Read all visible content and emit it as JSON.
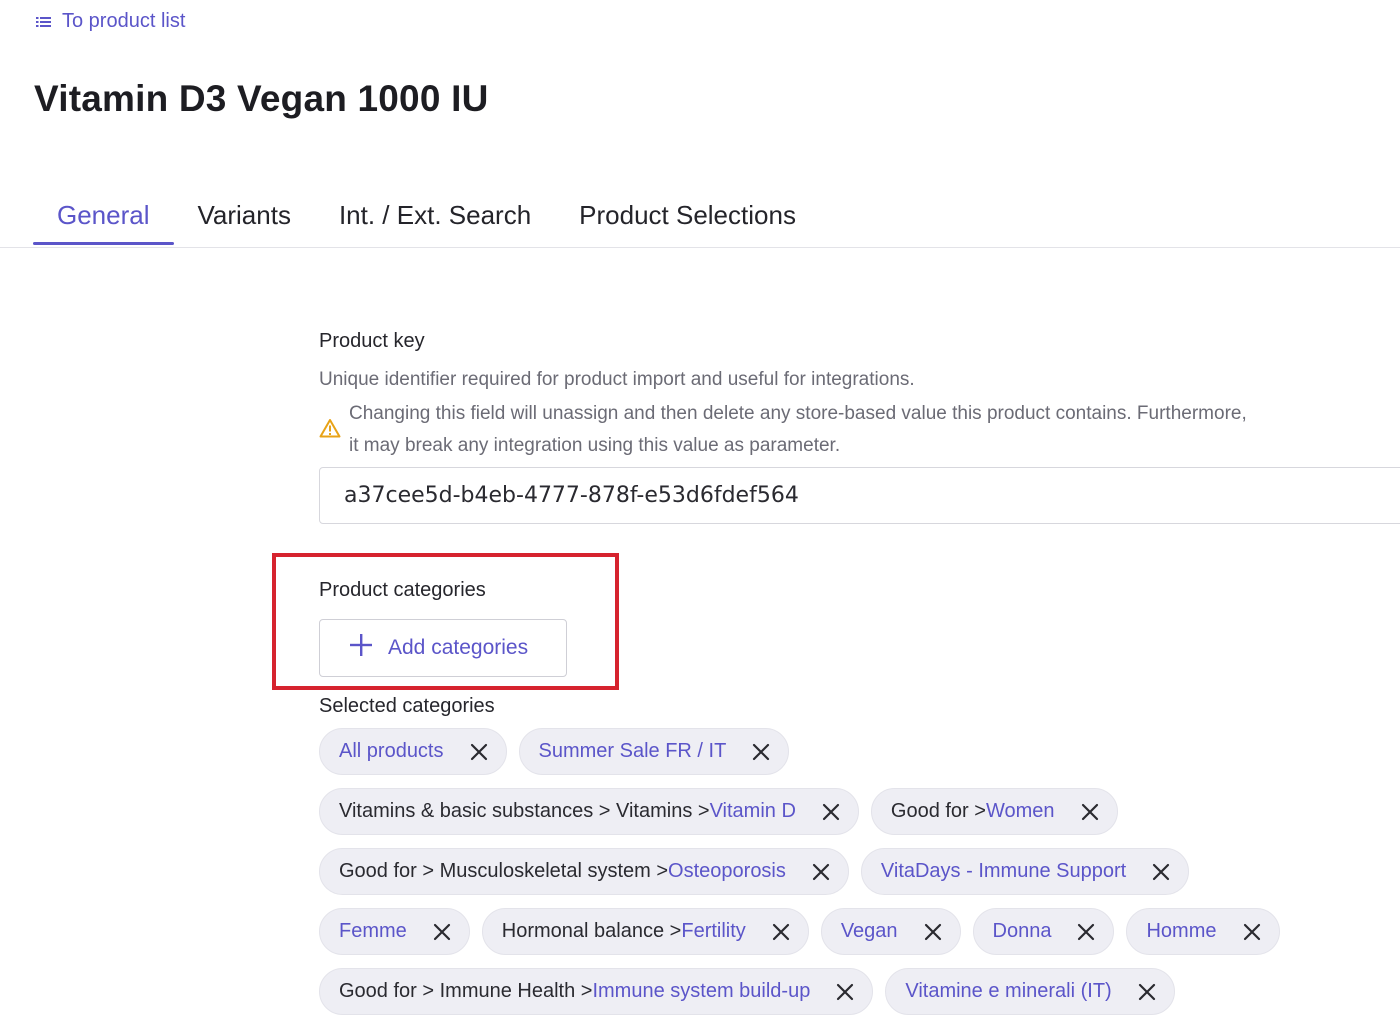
{
  "nav": {
    "back_label": "To product list"
  },
  "page": {
    "title": "Vitamin D3 Vegan 1000 IU"
  },
  "tabs": [
    {
      "label": "General",
      "active": true
    },
    {
      "label": "Variants",
      "active": false
    },
    {
      "label": "Int. / Ext. Search",
      "active": false
    },
    {
      "label": "Product Selections",
      "active": false
    }
  ],
  "product_key": {
    "label": "Product key",
    "description": "Unique identifier required for product import and useful for integrations.",
    "warning_line1": "Changing this field will unassign and then delete any store-based value this product contains. Furthermore,",
    "warning_line2": "it may break any integration using this value as parameter.",
    "value": "a37cee5d-b4eb-4777-878f-e53d6fdef564"
  },
  "categories": {
    "label": "Product categories",
    "add_button_label": "Add categories",
    "selected_label": "Selected categories",
    "rows": [
      [
        {
          "path": "",
          "leaf": "All products"
        },
        {
          "path": "",
          "leaf": "Summer Sale FR / IT"
        }
      ],
      [
        {
          "path": "Vitamins & basic substances > Vitamins > ",
          "leaf": "Vitamin D"
        },
        {
          "path": "Good for > ",
          "leaf": "Women"
        }
      ],
      [
        {
          "path": "Good for > Musculoskeletal system > ",
          "leaf": "Osteoporosis"
        },
        {
          "path": "",
          "leaf": "VitaDays - Immune Support"
        }
      ],
      [
        {
          "path": "",
          "leaf": "Femme"
        },
        {
          "path": "Hormonal balance > ",
          "leaf": "Fertility"
        },
        {
          "path": "",
          "leaf": "Vegan"
        },
        {
          "path": "",
          "leaf": "Donna"
        },
        {
          "path": "",
          "leaf": "Homme"
        }
      ],
      [
        {
          "path": "Good for > Immune Health > ",
          "leaf": "Immune system build-up"
        },
        {
          "path": "",
          "leaf": "Vitamine e minerali (IT)"
        }
      ]
    ]
  },
  "colors": {
    "accent": "#5b55c9",
    "highlight": "#d6232e",
    "warning": "#e8a317",
    "chip_bg": "#eeeef4"
  },
  "icons": {
    "back": "list-icon",
    "warning": "warning-triangle-icon",
    "add": "plus-icon",
    "remove": "close-icon"
  }
}
